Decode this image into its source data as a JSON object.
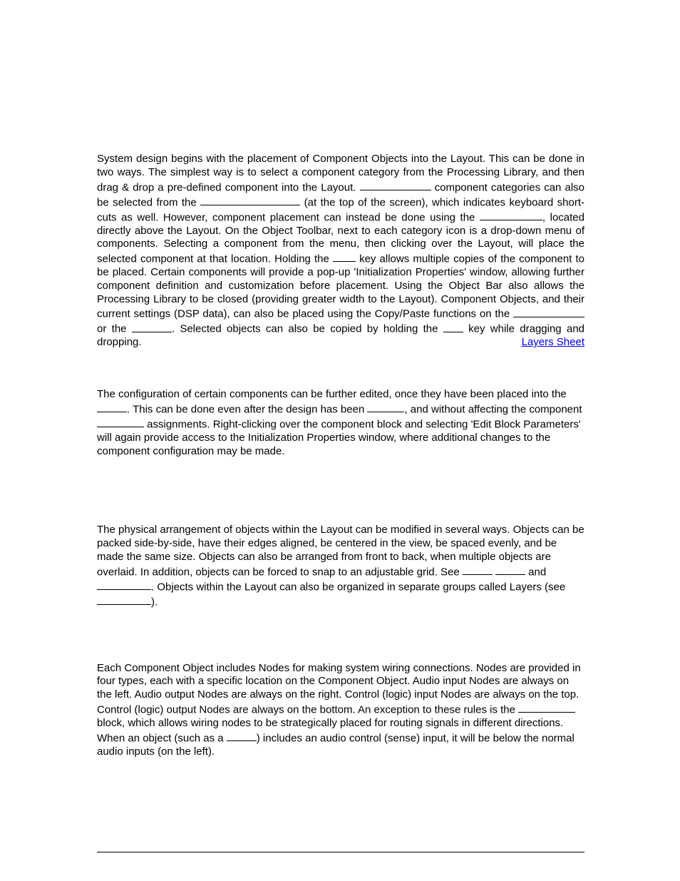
{
  "para1": {
    "t1": "System design begins with the placement of Component Objects into the Layout. This can be done in two ways. The simplest way is to select a component category from the Processing Library, and then drag & drop a pre-defined component into the Layout. ",
    "t2": " component categories can also be selected from the ",
    "t3": " (at the top of the screen), which indicates keyboard short-cuts as well. However, component placement can instead be done using the ",
    "t4": ", located directly above the Layout. On the Object Toolbar, next to each category icon is a drop-down menu of components. Selecting a component from the menu, then clicking over the Layout, will place the selected component at that location. Holding the ",
    "t5": " key allows multiple copies of the component to be placed. Certain components will provide a pop-up 'Initialization Properties' window, allowing further component definition and customization before placement. Using the Object Bar also allows the Processing Library to be closed (providing greater width to the Layout). Component Objects, and their current settings (DSP data), can also be placed using the Copy/Paste functions on the ",
    "t6": " or the ",
    "t7": ". Selected objects can also be copied by holding the ",
    "t8": " key while dragging and dropping.",
    "link": "Layers Sheet"
  },
  "para2": {
    "t1": "The configuration of certain components can be further edited, once they have been placed into the ",
    "t2": ". This can be done even after the design has been ",
    "t3": ", and without affecting the component ",
    "t4": " assignments. Right-clicking over the component block and selecting 'Edit Block Parameters' will again provide access to the Initialization Properties window, where additional changes to the component configuration may be made."
  },
  "para3": {
    "t1": "The physical arrangement of objects within the Layout can be modified in several ways. Objects can be packed side-by-side, have their edges aligned, be centered in the view, be spaced evenly, and be made the same size. Objects can also be arranged from front to back, when multiple objects are overlaid. In addition, objects can be forced to snap to an adjustable grid. See ",
    "t2": " and ",
    "t3": ". Objects within the Layout can also be organized in separate groups called Layers (see ",
    "t4": ")."
  },
  "para4": {
    "t1": "Each Component Object includes Nodes for making system wiring connections. Nodes are provided in four types, each with a specific location on the Component Object. Audio input Nodes are always on the left. Audio output Nodes are always on the right. Control (logic) input Nodes are always on the top. Control (logic) output Nodes are always on the bottom. An exception to these rules is the ",
    "t2": " block, which allows wiring nodes to be strategically placed for routing signals in different directions. When an object (such as a ",
    "t3": ") includes an audio control (sense) input, it will be below the normal audio inputs (on the left)."
  },
  "blanks": {
    "b_short": 40,
    "b_med": 55,
    "b_long1": 100,
    "b_long2": 140,
    "b_obj": 88,
    "b_ctrl": 32,
    "b_edit": 100,
    "b_tool": 56,
    "b_layout": 42,
    "b_comp": 52,
    "b_dsp": 66,
    "b_grid1": 42,
    "b_grid2": 42,
    "b_grid3": 76,
    "b_layers": 76,
    "b_pass": 80,
    "b_duck": 42
  }
}
